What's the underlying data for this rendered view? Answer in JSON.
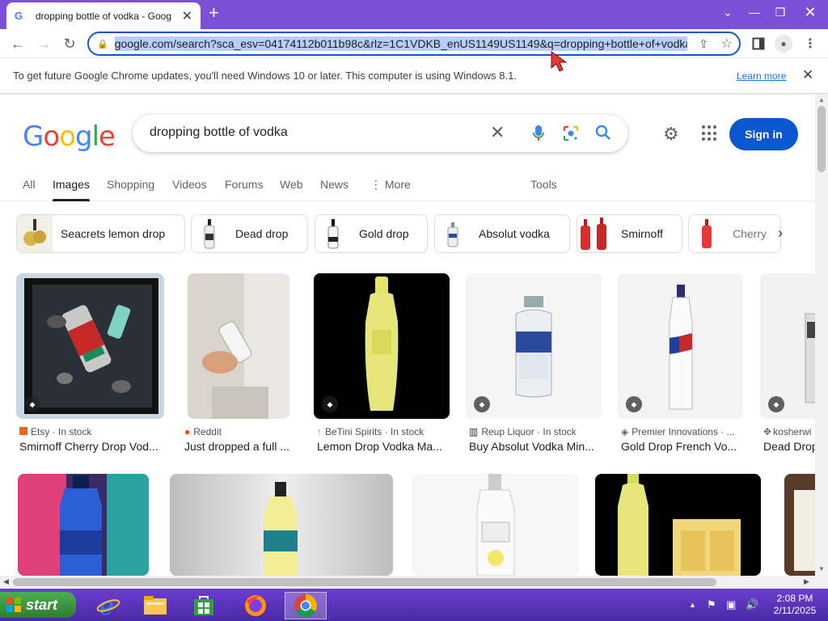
{
  "browser": {
    "tab_title": "dropping bottle of vodka - Goog",
    "url": "google.com/search?sca_esv=04174112b011b98c&rlz=1C1VDKB_enUS1149US1149&q=dropping+bottle+of+vodka",
    "infobar_message": "To get future Google Chrome updates, you'll need Windows 10 or later. This computer is using Windows 8.1.",
    "infobar_link": "Learn more"
  },
  "google": {
    "logo_letters": [
      "G",
      "o",
      "o",
      "g",
      "l",
      "e"
    ],
    "logo_colors": [
      "#4285F4",
      "#EA4335",
      "#FBBC05",
      "#4285F4",
      "#34A853",
      "#EA4335"
    ],
    "query": "dropping bottle of vodka",
    "signin_label": "Sign in",
    "tabs": [
      "All",
      "Images",
      "Shopping",
      "Videos",
      "Forums",
      "Web",
      "News",
      "More",
      "Tools"
    ],
    "active_tab": "Images",
    "chips": [
      "Seacrets lemon drop",
      "Dead drop",
      "Gold drop",
      "Absolut vodka",
      "Smirnoff",
      "Cherry"
    ],
    "results": [
      {
        "source": "Etsy · In stock",
        "title": "Smirnoff Cherry Drop Vod...",
        "icon_color": "#f1641e"
      },
      {
        "source": "Reddit",
        "title": "Just dropped a full ...",
        "icon_color": "#ff4500"
      },
      {
        "source": "BeTini Spirits · In stock",
        "title": "Lemon Drop Vodka Ma...",
        "icon_color": "#888888"
      },
      {
        "source": "Reup Liquor · In stock",
        "title": "Buy Absolut Vodka Min...",
        "icon_color": "#333333"
      },
      {
        "source": "Premier Innovations · ...",
        "title": "Gold Drop French Vo...",
        "icon_color": "#5f6368"
      },
      {
        "source": "kosherwi",
        "title": "Dead Drop",
        "icon_color": "#5f6368"
      }
    ]
  },
  "taskbar": {
    "start_label": "start",
    "time": "2:08 PM",
    "date": "2/11/2025"
  }
}
